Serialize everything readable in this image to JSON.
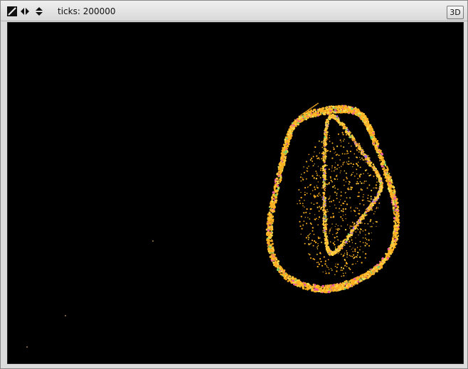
{
  "toolbar": {
    "ticks_text": "ticks: 200000",
    "view_3d_label": "3D"
  },
  "view": {
    "background_color": "#000000",
    "attractor_palette": [
      "#ffb020",
      "#ff9a24",
      "#ffd040",
      "#e85aa0",
      "#b06ad8",
      "#71d36b",
      "#f2e35a"
    ]
  },
  "icons": {
    "zoom": "zoom-icon",
    "pan": "pan-horizontal-icon",
    "vertical": "pan-vertical-icon"
  }
}
